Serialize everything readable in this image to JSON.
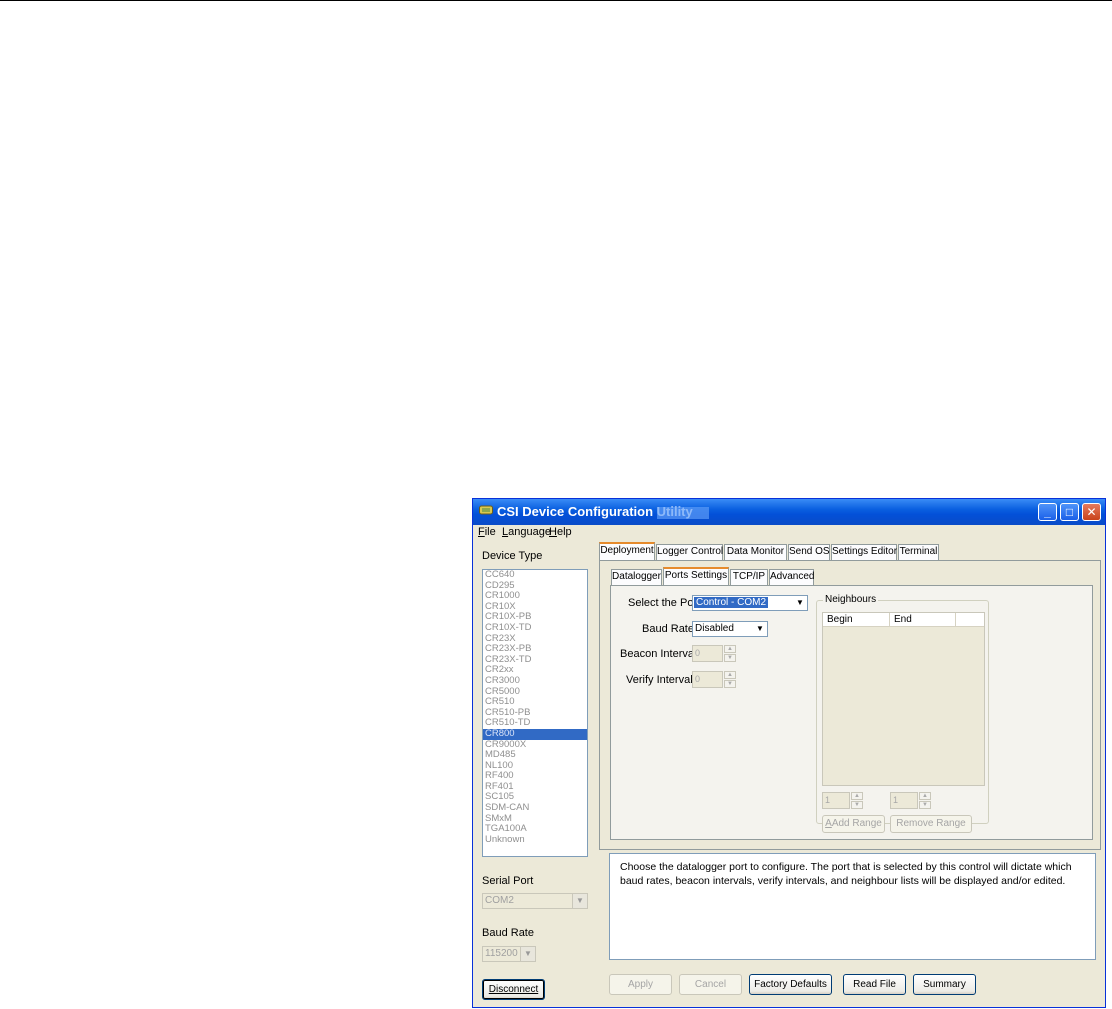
{
  "window": {
    "title": "CSI Device Configuration Utility",
    "min_glyph": "_",
    "max_glyph": "□",
    "close_glyph": "✕"
  },
  "menu": [
    {
      "label": "File",
      "accel": "F",
      "rest": "ile"
    },
    {
      "label": "Language",
      "accel": "L",
      "rest": "anguage"
    },
    {
      "label": "Help",
      "accel": "H",
      "rest": "elp"
    }
  ],
  "left_panel": {
    "device_type_label": "Device Type",
    "devices": [
      "CC640",
      "CD295",
      "CR1000",
      "CR10X",
      "CR10X-PB",
      "CR10X-TD",
      "CR23X",
      "CR23X-PB",
      "CR23X-TD",
      "CR2xx",
      "CR3000",
      "CR5000",
      "CR510",
      "CR510-PB",
      "CR510-TD",
      "CR800",
      "CR9000X",
      "MD485",
      "NL100",
      "RF400",
      "RF401",
      "SC105",
      "SDM-CAN",
      "SMxM",
      "TGA100A",
      "Unknown"
    ],
    "selected_device": "CR800",
    "serial_port_label": "Serial Port",
    "serial_port_value": "COM2",
    "baud_rate_label": "Baud Rate",
    "baud_rate_value": "115200",
    "disconnect_label": "Disconnect"
  },
  "main_tabs": [
    "Deployment",
    "Logger Control",
    "Data Monitor",
    "Send OS",
    "Settings Editor",
    "Terminal"
  ],
  "sub_tabs": [
    "Datalogger",
    "Ports Settings",
    "TCP/IP",
    "Advanced"
  ],
  "ports": {
    "select_port_label": "Select the Port",
    "select_port_value": "Control - COM2",
    "baud_rate_label": "Baud Rate:",
    "baud_rate_value": "Disabled",
    "beacon_interval_label": "Beacon Interval:",
    "beacon_interval_value": "0",
    "verify_interval_label": "Verify Interval:",
    "verify_interval_value": "0"
  },
  "neighbours": {
    "title": "Neighbours",
    "columns": [
      "Begin",
      "End",
      ""
    ],
    "range_begin_value": "1",
    "range_end_value": "1",
    "add_range_label": "Add Range",
    "remove_range_label": "Remove Range"
  },
  "description": "Choose the datalogger port to configure. The port that is selected by this control will dictate which baud rates, beacon intervals, verify intervals, and neighbour lists will be displayed and/or edited.",
  "bottom_buttons": {
    "apply": "Apply",
    "cancel": "Cancel",
    "factory_defaults": "Factory Defaults",
    "read_file": "Read File",
    "summary": "Summary"
  },
  "colors": {
    "titlebar": "#0a5fe0",
    "selection": "#316ac5",
    "window_bg": "#ece9d8"
  }
}
